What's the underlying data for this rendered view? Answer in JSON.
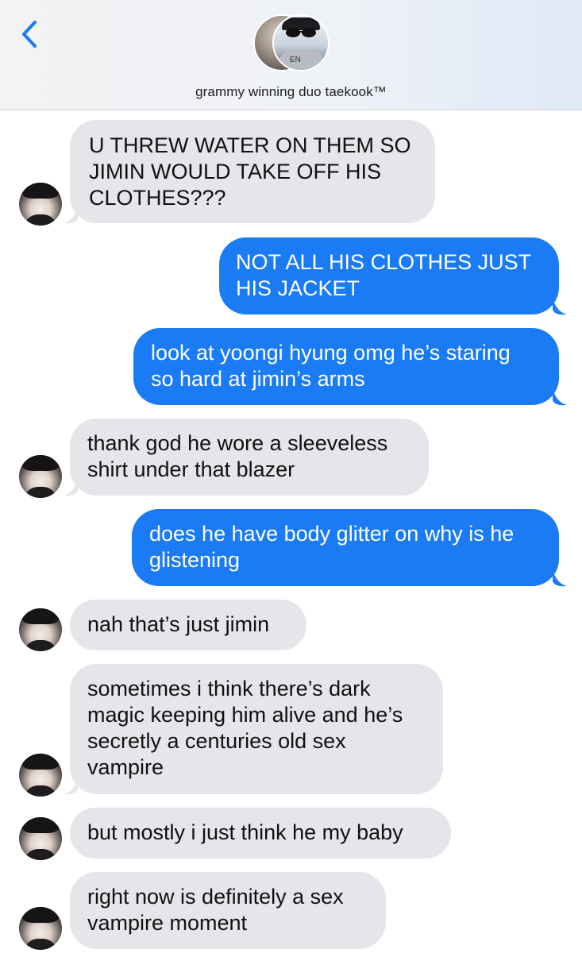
{
  "header": {
    "title": "grammy winning duo taekook™",
    "back_label": "Back",
    "avatar_badge_text": "EN"
  },
  "colors": {
    "sent_bubble": "#1a7bf4",
    "received_bubble": "#e5e5ea",
    "accent_back": "#1a7bf4"
  },
  "messages": [
    {
      "from": "them",
      "text": "U THREW WATER ON THEM SO\nJIMIN WOULD TAKE OFF HIS\nCLOTHES???"
    },
    {
      "from": "me",
      "text": "NOT ALL HIS CLOTHES JUST\nHIS JACKET"
    },
    {
      "from": "me",
      "text": "look at yoongi hyung omg he’s staring\nso hard at jimin’s arms"
    },
    {
      "from": "them",
      "text": "thank god he wore a sleeveless\nshirt under that blazer"
    },
    {
      "from": "me",
      "text": "does he have body glitter on why is he\nglistening"
    },
    {
      "from": "them",
      "text": "nah that’s just jimin"
    },
    {
      "from": "them",
      "text": "sometimes i think there’s dark\nmagic keeping him alive and he’s\nsecretly a centuries old sex\nvampire"
    },
    {
      "from": "them",
      "text": "but mostly i just think he my baby"
    },
    {
      "from": "them",
      "text": "right now is definitely a sex\nvampire moment"
    }
  ]
}
